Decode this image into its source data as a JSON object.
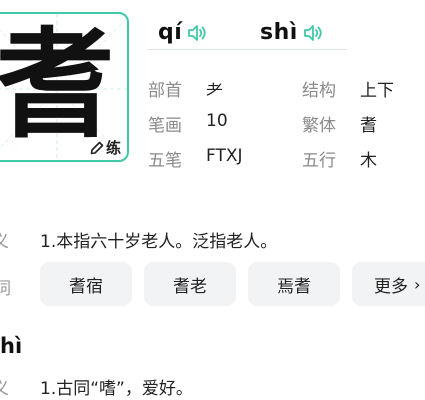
{
  "character": {
    "glyph": "耆",
    "practice_label": "练"
  },
  "pronunciations": [
    {
      "pinyin": "qí"
    },
    {
      "pinyin": "shì"
    }
  ],
  "info": {
    "radical_label": "部首",
    "radical_value": "耂",
    "structure_label": "结构",
    "structure_value": "上下",
    "strokes_label": "笔画",
    "strokes_value": "10",
    "traditional_label": "繁体",
    "traditional_value": "耆",
    "wubi_label": "五笔",
    "wubi_value": "FTXJ",
    "element_label": "五行",
    "element_value": "木"
  },
  "section1": {
    "meaning_label": "义",
    "meaning": "1.本指六十岁老人。泛指老人。",
    "words_label": "词",
    "words": [
      "耆宿",
      "耆老",
      "焉耆"
    ],
    "more_label": "更多",
    "more_arrow": "›"
  },
  "section2": {
    "pinyin": "hì",
    "meaning_label": "义",
    "meaning": "1.古同“嗜”，爱好。"
  },
  "colors": {
    "accent": "#3fc9a8",
    "chip_bg": "#f2f3f5"
  }
}
